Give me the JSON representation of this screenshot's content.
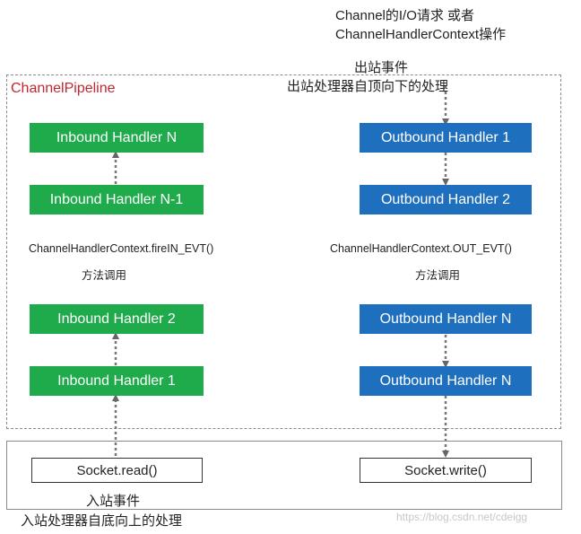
{
  "top_text": {
    "line1": "Channel的I/O请求 或者",
    "line2": "ChannelHandlerContext操作",
    "outbound_event": "出站事件",
    "outbound_order": "出站处理器自顶向下的处理"
  },
  "pipeline": {
    "title": "ChannelPipeline"
  },
  "inbound": {
    "handlers": [
      "Inbound Handler N",
      "Inbound Handler N-1",
      "Inbound Handler 2",
      "Inbound Handler 1"
    ],
    "context_call": "ChannelHandlerContext.fireIN_EVT()",
    "method_note": "方法调用",
    "socket": "Socket.read()",
    "event": "入站事件",
    "order": "入站处理器自底向上的处理"
  },
  "outbound": {
    "handlers": [
      "Outbound Handler  1",
      "Outbound Handler  2",
      "Outbound Handler  N",
      "Outbound Handler  N"
    ],
    "context_call": "ChannelHandlerContext.OUT_EVT()",
    "method_note": "方法调用",
    "socket": "Socket.write()"
  },
  "watermark": "https://blog.csdn.net/cdeigg",
  "colors": {
    "inbound": "#1faa4c",
    "outbound": "#1f6fbf",
    "pipeline_title": "#c0282d"
  }
}
